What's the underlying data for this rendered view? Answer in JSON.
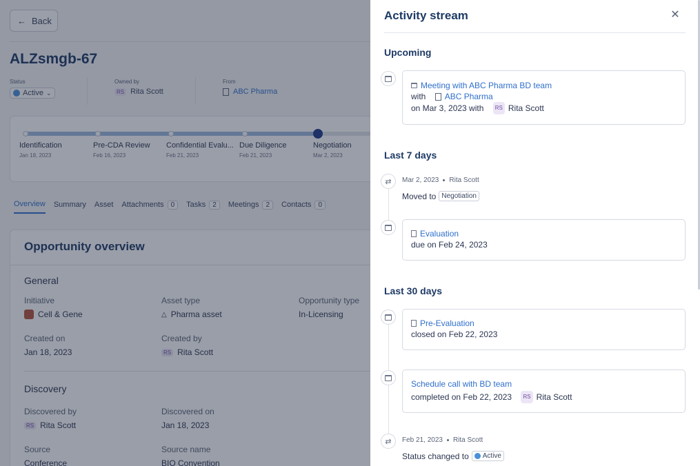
{
  "background": {
    "back_label": "Back",
    "title": "ALZsmgb-67",
    "status": {
      "label": "Status",
      "value": "Active"
    },
    "owner": {
      "label": "Owned by",
      "initials": "RS",
      "name": "Rita Scott"
    },
    "from": {
      "label": "From",
      "value": "ABC Pharma"
    },
    "stages": [
      {
        "name": "Identification",
        "date": "Jan 18, 2023"
      },
      {
        "name": "Pre-CDA Review",
        "date": "Feb 16, 2023"
      },
      {
        "name": "Confidential Evalu...",
        "date": "Feb 21, 2023"
      },
      {
        "name": "Due Diligence",
        "date": "Feb 21, 2023"
      },
      {
        "name": "Negotiation",
        "date": "Mar 2, 2023"
      }
    ],
    "tabs": [
      {
        "label": "Overview",
        "count": null
      },
      {
        "label": "Summary",
        "count": null
      },
      {
        "label": "Asset",
        "count": null
      },
      {
        "label": "Attachments",
        "count": "0"
      },
      {
        "label": "Tasks",
        "count": "2"
      },
      {
        "label": "Meetings",
        "count": "2"
      },
      {
        "label": "Contacts",
        "count": "0"
      }
    ],
    "overview": {
      "title": "Opportunity overview",
      "general_heading": "General",
      "initiative": {
        "label": "Initiative",
        "value": "Cell & Gene"
      },
      "asset_type": {
        "label": "Asset type",
        "value": "Pharma asset"
      },
      "opportunity_type": {
        "label": "Opportunity type",
        "value": "In-Licensing"
      },
      "created_on": {
        "label": "Created on",
        "value": "Jan 18, 2023"
      },
      "created_by": {
        "label": "Created by",
        "initials": "RS",
        "value": "Rita Scott"
      },
      "discovery_heading": "Discovery",
      "discovered_by": {
        "label": "Discovered by",
        "initials": "RS",
        "value": "Rita Scott"
      },
      "discovered_on": {
        "label": "Discovered on",
        "value": "Jan 18, 2023"
      },
      "source": {
        "label": "Source",
        "value": "Conference"
      },
      "source_name": {
        "label": "Source name",
        "value": "BIO Convention"
      }
    }
  },
  "drawer": {
    "title": "Activity stream",
    "close_icon": "close-icon",
    "groups": {
      "upcoming": "Upcoming",
      "last7": "Last 7 days",
      "last30": "Last 30 days"
    },
    "events": {
      "meeting": {
        "title": "Meeting with ABC Pharma BD team",
        "with_prefix": "with",
        "company": "ABC Pharma",
        "date_text": "on Mar 3, 2023 with",
        "initials": "RS",
        "person": "Rita Scott"
      },
      "moved": {
        "date": "Mar 2, 2023",
        "person": "Rita Scott",
        "text": "Moved to",
        "tag": "Negotiation"
      },
      "evaluation": {
        "title": "Evaluation",
        "text": "due on Feb 24, 2023"
      },
      "pre_evaluation": {
        "title": "Pre-Evaluation",
        "text": "closed on Feb 22, 2023"
      },
      "schedule_call": {
        "title": "Schedule call with BD team",
        "text": "completed on Feb 22, 2023",
        "initials": "RS",
        "person": "Rita Scott"
      },
      "status_changed": {
        "date": "Feb 21, 2023",
        "person": "Rita Scott",
        "text": "Status changed to",
        "tag": "Active"
      }
    }
  }
}
